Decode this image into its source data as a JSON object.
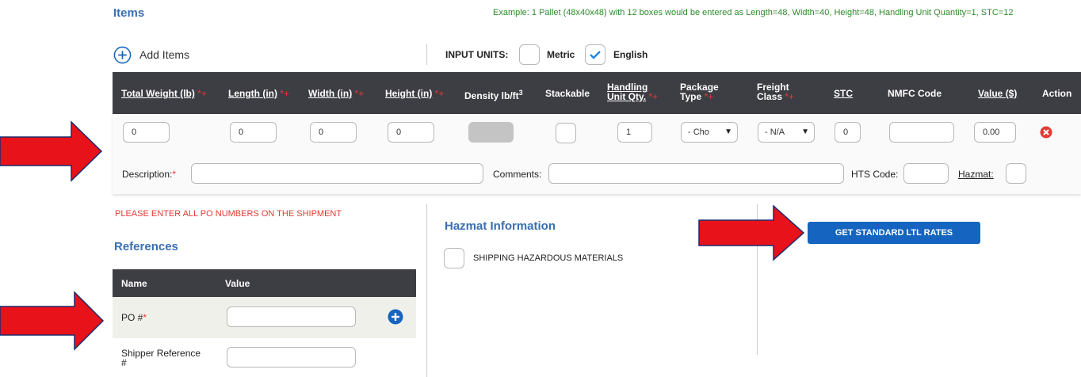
{
  "items": {
    "title": "Items",
    "example": "Example: 1 Pallet (48x40x48) with 12 boxes would be entered as Length=48, Width=40, Height=48, Handling Unit Quantity=1, STC=12",
    "add_items": "Add Items",
    "input_units_label": "INPUT UNITS:",
    "metric_label": "Metric",
    "english_label": "English",
    "english_checked": true,
    "metric_checked": false
  },
  "table": {
    "headers": {
      "total_weight": "Total Weight (lb)",
      "length": "Length (in)",
      "width": "Width (in)",
      "height": "Height (in)",
      "density": "Density lb/ft",
      "density_sup": "3",
      "stackable": "Stackable",
      "handling_1": "Handling",
      "handling_2": "Unit Qty.",
      "package_1": "Package",
      "package_2": "Type",
      "freight_1": "Freight",
      "freight_2": "Class",
      "stc": "STC",
      "nmfc": "NMFC Code",
      "value": "Value ($)",
      "action": "Action",
      "req_mark": "*+"
    },
    "row": {
      "total_weight": "0",
      "length": "0",
      "width": "0",
      "height": "0",
      "handling_qty": "1",
      "package_type": "- Cho",
      "freight_class": "- N/A",
      "stc": "0",
      "nmfc": "",
      "value": "0.00"
    },
    "description_label": "Description:",
    "comments_label": "Comments:",
    "hts_label": "HTS Code:",
    "hazmat_label": "Hazmat:",
    "req_star": "*"
  },
  "references": {
    "notice": "PLEASE ENTER ALL PO NUMBERS ON THE SHIPMENT",
    "title": "References",
    "col_name": "Name",
    "col_value": "Value",
    "po_label": "PO #",
    "shipper_ref_label_1": "Shipper Reference",
    "shipper_ref_label_2": "#",
    "req_star": "*"
  },
  "hazmat": {
    "title": "Hazmat Information",
    "checkbox_label": "SHIPPING HAZARDOUS MATERIALS"
  },
  "actions": {
    "get_rates": "GET STANDARD LTL RATES"
  },
  "colors": {
    "header_bg": "#3d3d44",
    "accent_blue": "#1565c0",
    "arrow_red": "#e8121a",
    "notice_red": "#e53935",
    "example_green": "#2e8b2e"
  }
}
